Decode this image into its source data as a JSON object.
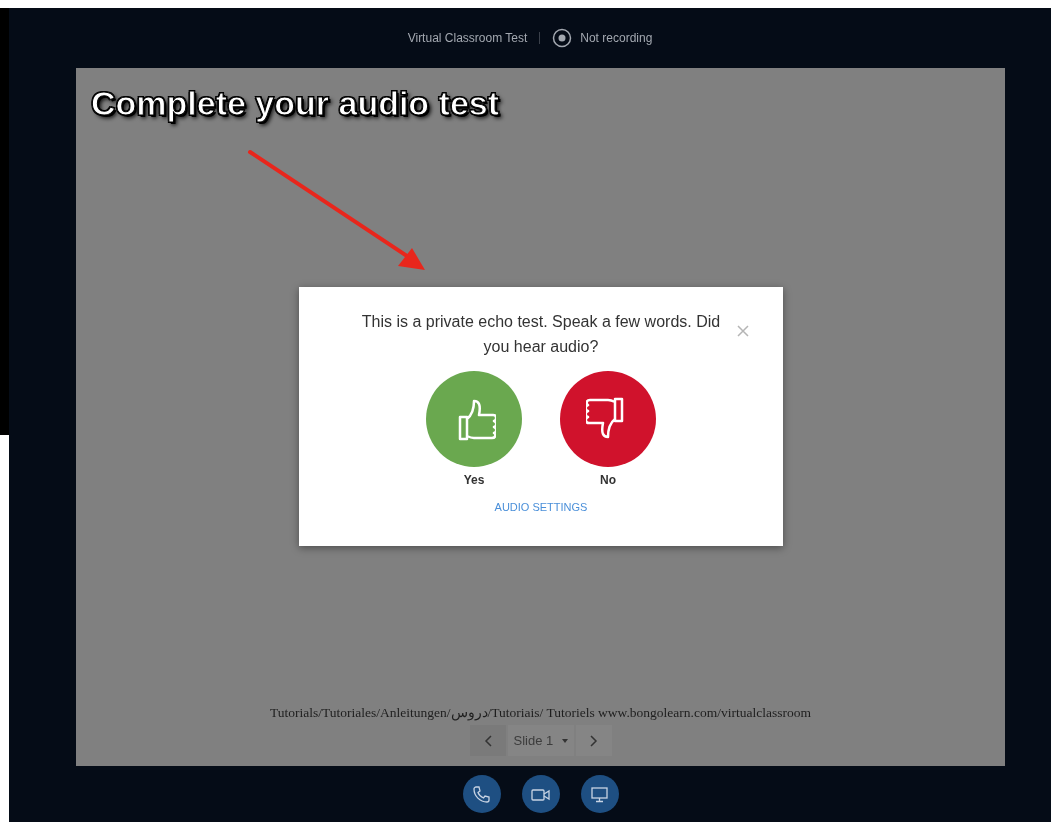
{
  "header": {
    "title": "Virtual Classroom Test",
    "recording": {
      "label": "Not recording",
      "on": false
    }
  },
  "annotation": {
    "text": "Complete your audio test"
  },
  "dialog": {
    "message": "This is a private echo test. Speak a few words. Did you hear audio?",
    "choices": [
      {
        "kind": "yes",
        "label": "Yes"
      },
      {
        "kind": "no",
        "label": "No"
      }
    ],
    "link": "AUDIO SETTINGS"
  },
  "slide": {
    "caption": "Tutorials/Tutoriales/Anleitungen/دروس/Tutoriais/ Tutoriels www.bongolearn.com/virtualclassroom",
    "selector": "Slide 1"
  },
  "controls": [
    {
      "kind": "phone"
    },
    {
      "kind": "camera"
    },
    {
      "kind": "screen"
    }
  ]
}
